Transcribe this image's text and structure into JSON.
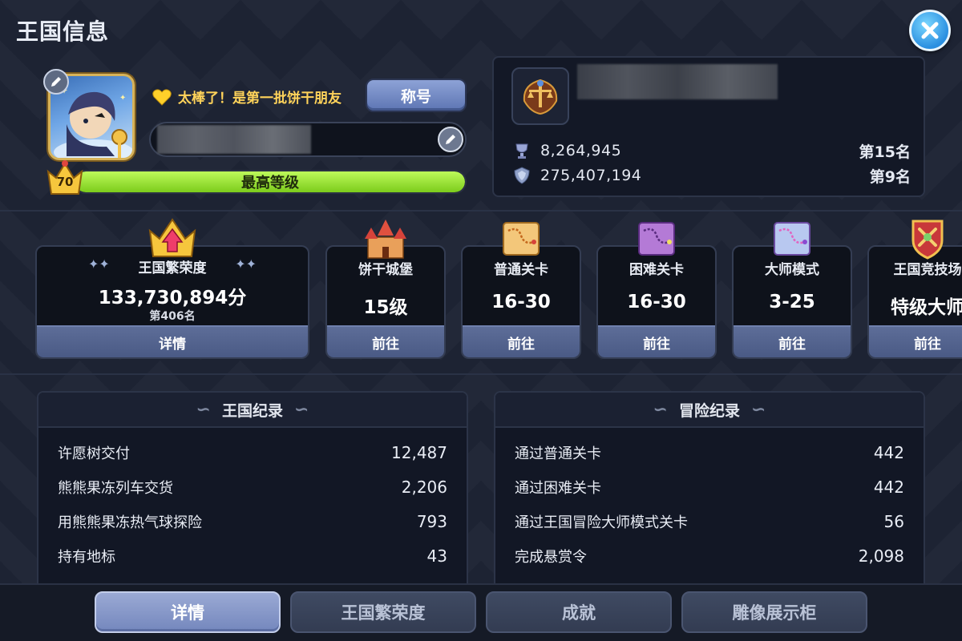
{
  "header": {
    "title": "王国信息"
  },
  "profile": {
    "friend_message": "太棒了！是第一批饼干朋友",
    "title_button": "称号",
    "level": "70",
    "level_label": "最高等级",
    "level_progress": 1.0
  },
  "guild": {
    "stats": [
      {
        "icon": "trophy-cup-icon",
        "value": "8,264,945",
        "rank": "第15名"
      },
      {
        "icon": "shield-trophy-icon",
        "value": "275,407,194",
        "rank": "第9名"
      }
    ]
  },
  "cards": [
    {
      "label": "王国繁荣度",
      "value": "133,730,894分",
      "rank": "第406名",
      "button": "详情",
      "icon": "prosperity-crown-icon"
    },
    {
      "label": "饼干城堡",
      "value": "15级",
      "button": "前往",
      "icon": "castle-icon"
    },
    {
      "label": "普通关卡",
      "value": "16-30",
      "button": "前往",
      "icon": "normal-map-icon"
    },
    {
      "label": "困难关卡",
      "value": "16-30",
      "button": "前往",
      "icon": "hard-map-icon"
    },
    {
      "label": "大师模式",
      "value": "3-25",
      "button": "前往",
      "icon": "master-map-icon"
    },
    {
      "label": "王国竞技场",
      "value": "特级大师",
      "button": "前往",
      "icon": "arena-shield-icon"
    }
  ],
  "kingdom_records": {
    "title": "王国纪录",
    "rows": [
      {
        "label": "许愿树交付",
        "value": "12,487"
      },
      {
        "label": "熊熊果冻列车交货",
        "value": "2,206"
      },
      {
        "label": "用熊熊果冻热气球探险",
        "value": "793"
      },
      {
        "label": "持有地标",
        "value": "43"
      }
    ]
  },
  "adventure_records": {
    "title": "冒险纪录",
    "rows": [
      {
        "label": "通过普通关卡",
        "value": "442"
      },
      {
        "label": "通过困难关卡",
        "value": "442"
      },
      {
        "label": "通过王国冒险大师模式关卡",
        "value": "56"
      },
      {
        "label": "完成悬赏令",
        "value": "2,098"
      }
    ]
  },
  "tabs": [
    {
      "label": "详情",
      "active": true
    },
    {
      "label": "王国繁荣度",
      "active": false
    },
    {
      "label": "成就",
      "active": false
    },
    {
      "label": "雕像展示柜",
      "active": false
    }
  ],
  "colors": {
    "accent_green": "#9be33a",
    "gold": "#ffd35a",
    "button_blue": "#5d75b3",
    "close_blue": "#2a8fe0"
  }
}
